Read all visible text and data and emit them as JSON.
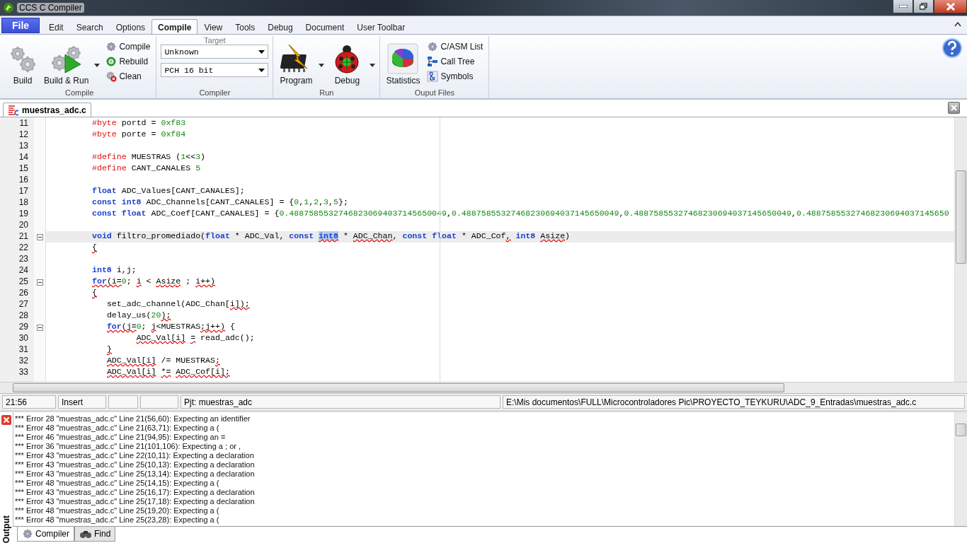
{
  "window": {
    "title": "CCS C Compiler"
  },
  "file_button": "File",
  "menu_tabs": [
    {
      "label": "Edit",
      "selected": false
    },
    {
      "label": "Search",
      "selected": false
    },
    {
      "label": "Options",
      "selected": false
    },
    {
      "label": "Compile",
      "selected": true
    },
    {
      "label": "View",
      "selected": false
    },
    {
      "label": "Tools",
      "selected": false
    },
    {
      "label": "Debug",
      "selected": false
    },
    {
      "label": "Document",
      "selected": false
    },
    {
      "label": "User Toolbar",
      "selected": false
    }
  ],
  "compile_group": {
    "label": "Compile",
    "build": "Build",
    "build_run": "Build & Run",
    "compile": "Compile",
    "rebuild": "Rebuild",
    "clean": "Clean"
  },
  "compiler_group": {
    "label": "Compiler",
    "caption": "Target",
    "target": "Unknown",
    "compiler": "PCH 16 bit"
  },
  "run_group": {
    "label": "Run",
    "program": "Program",
    "debug": "Debug"
  },
  "output_files_group": {
    "label": "Ouput Files",
    "statistics": "Statistics",
    "c_asm_list": "C/ASM List",
    "call_tree": "Call Tree",
    "symbols": "Symbols"
  },
  "doc_tabs": [
    {
      "label": "muestras_adc.c",
      "selected": true
    }
  ],
  "code_lines": [
    {
      "n": "11",
      "fold": false,
      "current": false,
      "tokens": [
        {
          "t": "#byte",
          "kind": "pp"
        },
        {
          "t": " portd = ",
          "kind": "txt"
        },
        {
          "t": "0xf83",
          "kind": "num"
        }
      ]
    },
    {
      "n": "12",
      "fold": false,
      "current": false,
      "tokens": [
        {
          "t": "#byte",
          "kind": "pp"
        },
        {
          "t": " porte = ",
          "kind": "txt"
        },
        {
          "t": "0xf84",
          "kind": "num"
        }
      ]
    },
    {
      "n": "13",
      "fold": false,
      "current": false
    },
    {
      "n": "14",
      "fold": false,
      "current": false,
      "tokens": [
        {
          "t": "#define",
          "kind": "pp"
        },
        {
          "t": " MUESTRAS (",
          "kind": "txt"
        },
        {
          "t": "1",
          "kind": "num"
        },
        {
          "t": "<<",
          "kind": "txt"
        },
        {
          "t": "3",
          "kind": "num"
        },
        {
          "t": ")",
          "kind": "txt"
        }
      ]
    },
    {
      "n": "15",
      "fold": false,
      "current": false,
      "tokens": [
        {
          "t": "#define",
          "kind": "pp"
        },
        {
          "t": " CANT_CANALES ",
          "kind": "txt"
        },
        {
          "t": "5",
          "kind": "num"
        }
      ]
    },
    {
      "n": "16",
      "fold": false,
      "current": false
    },
    {
      "n": "17",
      "fold": false,
      "current": false,
      "tokens": [
        {
          "t": "float",
          "kind": "kw"
        },
        {
          "t": " ADC_Values[CANT_CANALES];",
          "kind": "txt"
        }
      ]
    },
    {
      "n": "18",
      "fold": false,
      "current": false,
      "tokens": [
        {
          "t": "const int8",
          "kind": "kw"
        },
        {
          "t": " ADC_Channels[CANT_CANALES] = {",
          "kind": "txt"
        },
        {
          "t": "0",
          "kind": "num"
        },
        {
          "t": ",",
          "kind": "txt"
        },
        {
          "t": "1",
          "kind": "num"
        },
        {
          "t": ",",
          "kind": "txt"
        },
        {
          "t": "2",
          "kind": "num"
        },
        {
          "t": ",",
          "kind": "txt"
        },
        {
          "t": "3",
          "kind": "num"
        },
        {
          "t": ",",
          "kind": "txt"
        },
        {
          "t": "5",
          "kind": "num"
        },
        {
          "t": "};",
          "kind": "txt"
        }
      ]
    },
    {
      "n": "19",
      "fold": false,
      "current": false,
      "tokens": [
        {
          "t": "const float",
          "kind": "kw"
        },
        {
          "t": " ADC_Coef[CANT_CANALES] = {",
          "kind": "txt"
        },
        {
          "t": "0.48875855327468230694037145650049",
          "kind": "num"
        },
        {
          "t": ",",
          "kind": "txt"
        },
        {
          "t": "0.48875855327468230694037145650049",
          "kind": "num"
        },
        {
          "t": ",",
          "kind": "txt"
        },
        {
          "t": "0.48875855327468230694037145650049",
          "kind": "num"
        },
        {
          "t": ",",
          "kind": "txt"
        },
        {
          "t": "0.48875855327468230694037145650",
          "kind": "num"
        }
      ]
    },
    {
      "n": "20",
      "fold": false,
      "current": false
    },
    {
      "n": "21",
      "fold": true,
      "current": true,
      "tokens": [
        {
          "t": "void",
          "kind": "kw"
        },
        {
          "t": " filtro_promediado(",
          "kind": "txt"
        },
        {
          "t": "float",
          "kind": "kw"
        },
        {
          "t": " * ADC_Val, ",
          "kind": "txt"
        },
        {
          "t": "const ",
          "kind": "kw"
        },
        {
          "t": "int8",
          "kind": "sel"
        },
        {
          "t": " * ",
          "kind": "txt"
        },
        {
          "t": "ADC_Chan",
          "kind": "err"
        },
        {
          "t": ", ",
          "kind": "txt"
        },
        {
          "t": "const float",
          "kind": "kw"
        },
        {
          "t": " * ADC_Cof",
          "kind": "txt"
        },
        {
          "t": ",",
          "kind": "err"
        },
        {
          "t": " int8",
          "kind": "kw"
        },
        {
          "t": " Asize",
          "kind": "err"
        },
        {
          "t": ")",
          "kind": "txt"
        }
      ]
    },
    {
      "n": "22",
      "fold": false,
      "current": false,
      "tokens": [
        {
          "t": "{",
          "kind": "err"
        }
      ]
    },
    {
      "n": "23",
      "fold": false,
      "current": false
    },
    {
      "n": "24",
      "fold": false,
      "current": false,
      "tokens": [
        {
          "t": "int8",
          "kind": "kw"
        },
        {
          "t": " i,j;",
          "kind": "txt"
        }
      ]
    },
    {
      "n": "25",
      "fold": true,
      "current": false,
      "tokens": [
        {
          "t": "for",
          "kind": "errkw"
        },
        {
          "t": "(i=",
          "kind": "err"
        },
        {
          "t": "0",
          "kind": "num"
        },
        {
          "t": "; ",
          "kind": "txt"
        },
        {
          "t": "i",
          "kind": "err"
        },
        {
          "t": " < ",
          "kind": "txt"
        },
        {
          "t": "Asize",
          "kind": "err"
        },
        {
          "t": " ; ",
          "kind": "txt"
        },
        {
          "t": "i++)",
          "kind": "err"
        }
      ]
    },
    {
      "n": "26",
      "fold": false,
      "current": false,
      "tokens": [
        {
          "t": "{",
          "kind": "err"
        }
      ]
    },
    {
      "n": "27",
      "fold": false,
      "current": false,
      "tokens": [
        {
          "t": "   set_adc_channel(ADC_Chan[",
          "kind": "txt"
        },
        {
          "t": "i]);",
          "kind": "err"
        }
      ]
    },
    {
      "n": "28",
      "fold": false,
      "current": false,
      "tokens": [
        {
          "t": "   delay_us(",
          "kind": "txt"
        },
        {
          "t": "20",
          "kind": "num"
        },
        {
          "t": ");",
          "kind": "err"
        }
      ]
    },
    {
      "n": "29",
      "fold": true,
      "current": false,
      "tokens": [
        {
          "t": "   for",
          "kind": "errkw"
        },
        {
          "t": "(j=",
          "kind": "err"
        },
        {
          "t": "0",
          "kind": "num"
        },
        {
          "t": "; ",
          "kind": "txt"
        },
        {
          "t": "j",
          "kind": "err"
        },
        {
          "t": "<MUESTRAS",
          "kind": "txt"
        },
        {
          "t": ";j++)",
          "kind": "err"
        },
        {
          "t": " {",
          "kind": "txt"
        }
      ]
    },
    {
      "n": "30",
      "fold": false,
      "current": false,
      "tokens": [
        {
          "t": "         ADC_Val[i]",
          "kind": "err"
        },
        {
          "t": " =",
          "kind": "err"
        },
        {
          "t": " read_adc();",
          "kind": "txt"
        }
      ]
    },
    {
      "n": "31",
      "fold": false,
      "current": false,
      "tokens": [
        {
          "t": "   }",
          "kind": "err"
        }
      ]
    },
    {
      "n": "32",
      "fold": false,
      "current": false,
      "tokens": [
        {
          "t": "   ADC_Val[i]",
          "kind": "err"
        },
        {
          "t": " /= MUESTRAS",
          "kind": "txt"
        },
        {
          "t": ";",
          "kind": "err"
        }
      ]
    },
    {
      "n": "33",
      "fold": false,
      "current": false,
      "tokens": [
        {
          "t": "   ADC_Val[i]",
          "kind": "err"
        },
        {
          "t": " *=",
          "kind": "err"
        },
        {
          "t": " ADC_Cof[i];",
          "kind": "err"
        }
      ]
    }
  ],
  "status_bar": {
    "position": "21:56",
    "mode": "Insert",
    "project": "Pjt: muestras_adc",
    "path": "E:\\Mis documentos\\FULL\\Microcontroladores Pic\\PROYECTO_TEYKURU\\ADC_9_Entradas\\muestras_adc.c"
  },
  "output": {
    "title": "Output",
    "messages": [
      "*** Error 28 \"muestras_adc.c\" Line 21(56,60): Expecting an identifier",
      "*** Error 48 \"muestras_adc.c\" Line 21(63,71): Expecting a (",
      "*** Error 46 \"muestras_adc.c\" Line 21(94,95): Expecting an =",
      "*** Error 36 \"muestras_adc.c\" Line 21(101,106): Expecting a ; or ,",
      "*** Error 43 \"muestras_adc.c\" Line 22(10,11): Expecting a declaration",
      "*** Error 43 \"muestras_adc.c\" Line 25(10,13): Expecting a declaration",
      "*** Error 43 \"muestras_adc.c\" Line 25(13,14): Expecting a declaration",
      "*** Error 48 \"muestras_adc.c\" Line 25(14,15): Expecting a (",
      "*** Error 43 \"muestras_adc.c\" Line 25(16,17): Expecting a declaration",
      "*** Error 43 \"muestras_adc.c\" Line 25(17,18): Expecting a declaration",
      "*** Error 48 \"muestras_adc.c\" Line 25(19,20): Expecting a (",
      "*** Error 48 \"muestras_adc.c\" Line 25(23,28): Expecting a ("
    ],
    "tabs": [
      {
        "label": "Compiler",
        "selected": true
      },
      {
        "label": "Find",
        "selected": false
      }
    ]
  }
}
